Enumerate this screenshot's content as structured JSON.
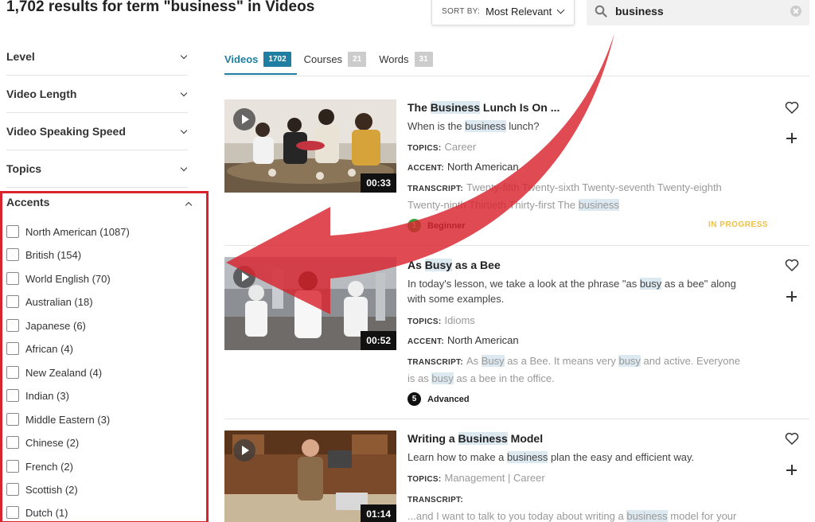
{
  "header": {
    "results_title": "1,702 results for term \"business\" in Videos",
    "sort_label": "SORT BY:",
    "sort_value": "Most Relevant",
    "search_value": "business"
  },
  "filters": [
    {
      "label": "Level"
    },
    {
      "label": "Video Length"
    },
    {
      "label": "Video Speaking Speed"
    },
    {
      "label": "Topics"
    }
  ],
  "accents": {
    "label": "Accents",
    "options": [
      "North American (1087)",
      "British (154)",
      "World English (70)",
      "Australian (18)",
      "Japanese (6)",
      "African (4)",
      "New Zealand (4)",
      "Indian (3)",
      "Middle Eastern (3)",
      "Chinese (2)",
      "French (2)",
      "Scottish (2)",
      "Dutch (1)"
    ]
  },
  "tabs": [
    {
      "label": "Videos",
      "count": "1702"
    },
    {
      "label": "Courses",
      "count": "21"
    },
    {
      "label": "Words",
      "count": "31"
    }
  ],
  "labels": {
    "topics": "TOPICS:",
    "accent": "ACCENT:",
    "transcript": "TRANSCRIPT:"
  },
  "videos": [
    {
      "title_pre": "The ",
      "title_hl": "Business",
      "title_post": " Lunch Is On ...",
      "desc_pre": "When is the ",
      "desc_hl": "business",
      "desc_post": " lunch?",
      "topics": "Career",
      "accent": "North American",
      "transcript_pre": "Twenty-fifth Twenty-sixth Twenty-seventh Twenty-eighth Twenty-ninth Thirtieth Thirty-first The ",
      "transcript_hl": "business",
      "level_num": "1",
      "level": "Beginner",
      "status": "IN PROGRESS",
      "duration": "00:33"
    },
    {
      "title_pre": "As ",
      "title_hl": "Busy",
      "title_post": " as a Bee",
      "desc_pre": "In today's lesson, we take a look at the phrase \"as ",
      "desc_hl": "busy",
      "desc_post": " as a bee\" along with some examples.",
      "topics": "Idioms",
      "accent": "North American",
      "transcript_1": "As ",
      "transcript_hl1": "Busy",
      "transcript_2": " as a Bee. It means very ",
      "transcript_hl2": "busy",
      "transcript_3": " and active. Everyone is as ",
      "transcript_hl3": "busy",
      "transcript_4": " as a bee in the office.",
      "level_num": "5",
      "level": "Advanced",
      "duration": "00:52"
    },
    {
      "title_pre": "Writing a ",
      "title_hl": "Business",
      "title_post": " Model",
      "desc_pre": "Learn how to make a ",
      "desc_hl": "business",
      "desc_post": " plan the easy and efficient way.",
      "topics": "Management | Career",
      "transcript_pre": "...and I want to talk to you today about writing a ",
      "transcript_hl": "business",
      "transcript_post": " model for your",
      "duration": "01:14"
    }
  ],
  "colors": {
    "accent_blue": "#1f7ea1",
    "highlight_frame": "#d9232d",
    "arrow": "#d9232d",
    "in_progress": "#f0c040",
    "beginner_dot": "#3aa23d"
  }
}
